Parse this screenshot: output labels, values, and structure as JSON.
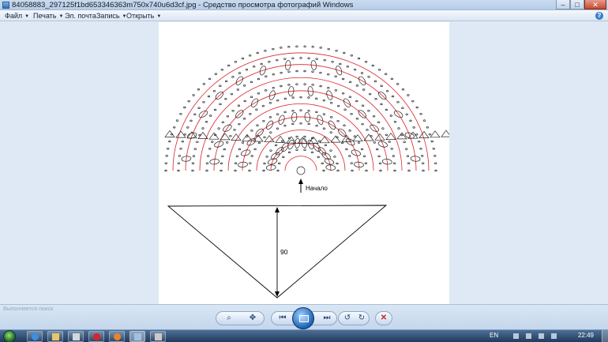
{
  "window": {
    "title": "84058883_297125f1bd653346363m750x740u6d3cf.jpg - Средство просмотра фотографий Windows",
    "controls": {
      "minimize": "–",
      "maximize": "□",
      "close": "✕"
    }
  },
  "menu": {
    "items": [
      {
        "label": "Файл"
      },
      {
        "label": "Печать"
      },
      {
        "label": "Эл. почта"
      },
      {
        "label": "Запись"
      },
      {
        "label": "Открыть"
      }
    ],
    "help": "?"
  },
  "photo": {
    "start_label": "Начало",
    "dimension_label": "90",
    "colors": {
      "stitch": "#222222",
      "rows": "#d8242a"
    }
  },
  "controlbar": {
    "ghost_text": "Выполняется поиск",
    "buttons": {
      "zoom": "zoom-icon",
      "actual_size": "actual-size-icon",
      "previous": "previous-icon",
      "slideshow": "slideshow-icon",
      "next": "next-icon",
      "rotate_left": "rotate-ccw-icon",
      "rotate_right": "rotate-cw-icon",
      "delete": "delete-icon"
    }
  },
  "taskbar": {
    "lang": "EN",
    "clock": "22:49"
  }
}
